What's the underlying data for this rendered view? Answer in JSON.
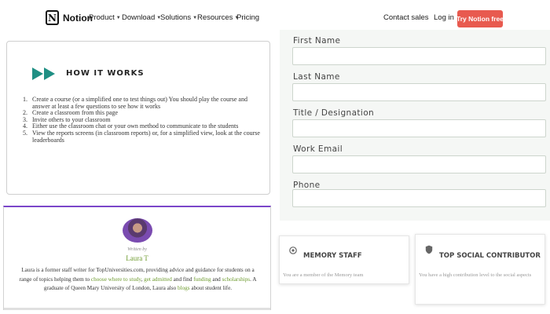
{
  "nav": {
    "brand": "Notion",
    "items": [
      {
        "label": "Product",
        "has_menu": true
      },
      {
        "label": "Download",
        "has_menu": true
      },
      {
        "label": "Solutions",
        "has_menu": true
      },
      {
        "label": "Resources",
        "has_menu": true
      },
      {
        "label": "Pricing",
        "has_menu": false
      }
    ],
    "contact": "Contact sales",
    "login": "Log in",
    "cta": "Try Notion free",
    "cta_color": "#e85a4f"
  },
  "how_it_works": {
    "title": "HOW IT WORKS",
    "icon": "fast-forward-icon",
    "icon_color": "#1f8f84",
    "steps": [
      {
        "num": "1.",
        "text": "Create a course (or a simplified one to test things out)    You should play the course and answer at least a few questions to see how it works"
      },
      {
        "num": "2.",
        "text": "Create a classroom from this page"
      },
      {
        "num": "3.",
        "text": "Invite others to your classroom"
      },
      {
        "num": "4.",
        "text": "Either use the classroom chat or your own method to communicate to the students"
      },
      {
        "num": "5.",
        "text": "View the reports screens (in classroom reports) or, for a simplified view, look at the course leaderboards"
      }
    ]
  },
  "author": {
    "written_by": "Written by",
    "name": "Laura T",
    "bio_1": "Laura is a former staff writer for TopUniversities.com, providing advice and guidance for students on a range of topics helping them to ",
    "link_choose": "choose where to study",
    "sep_1": ", ",
    "link_admitted": "get admitted",
    "bio_2": " and find ",
    "link_funding": "funding",
    "bio_3": " and ",
    "link_scholarships": "scholarships",
    "bio_4": ". A graduate of Queen Mary University of London, Laura also ",
    "link_blogs": "blogs",
    "bio_5": " about student life.",
    "accent": "#7b46c9",
    "link_color": "#6e9b2f"
  },
  "form": {
    "fields": [
      {
        "label": "First Name",
        "value": ""
      },
      {
        "label": "Last Name",
        "value": ""
      },
      {
        "label": "Title / Designation",
        "value": ""
      },
      {
        "label": "Work Email",
        "value": ""
      },
      {
        "label": "Phone",
        "value": ""
      }
    ]
  },
  "badges": [
    {
      "title": "MEMORY STAFF",
      "desc": "You are a member of the Memory team",
      "icon": "badge-icon"
    },
    {
      "title": "TOP SOCIAL CONTRIBUTOR",
      "desc": "You have a high contribution level to the social aspects",
      "icon": "shield-icon"
    }
  ]
}
